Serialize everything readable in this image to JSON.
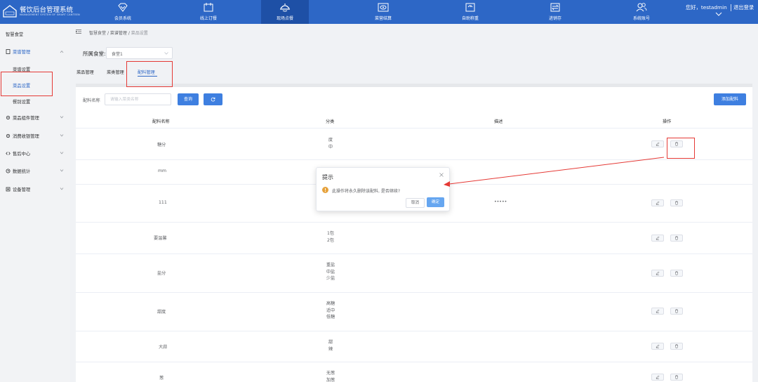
{
  "app": {
    "title": "餐饮后台管理系统",
    "subtitle": "MANAGEMENT SYSTEM OF SMART CANTEEN",
    "logo_text": "智慧食堂"
  },
  "nav": [
    {
      "label": "会员系统",
      "icon": "diamond-icon"
    },
    {
      "label": "线上订餐",
      "icon": "calendar-icon"
    },
    {
      "label": "现场点餐",
      "icon": "tray-icon",
      "active": true
    },
    {
      "label": "菜营结算",
      "icon": "eye-screen-icon"
    },
    {
      "label": "自助称重",
      "icon": "scale-icon"
    },
    {
      "label": "进销存",
      "icon": "exchange-icon"
    },
    {
      "label": "系统账号",
      "icon": "users-icon"
    }
  ],
  "user": {
    "greeting": "您好，testadmin",
    "logout": "退出登录"
  },
  "sidebar": {
    "head": "智慧食堂",
    "groups": [
      {
        "label": "菜谱管理",
        "open": true,
        "items": [
          "菜谱设置",
          "菜品设置",
          "餐别设置"
        ],
        "active_item": "菜品设置"
      },
      {
        "label": "菜品组件管理"
      },
      {
        "label": "消费收银管理"
      },
      {
        "label": "售后中心"
      },
      {
        "label": "数据统计"
      },
      {
        "label": "设备管理"
      }
    ]
  },
  "breadcrumb": {
    "items": [
      "智慧食堂",
      "菜谱管理",
      "菜品设置"
    ]
  },
  "filter": {
    "canteen_label": "所属食堂:",
    "canteen_value": "食堂1",
    "name_label": "配料名称",
    "name_placeholder": "请输入菜类名称",
    "search_label": "查询",
    "add_label": "添加配料"
  },
  "tabs": [
    {
      "label": "菜品管理"
    },
    {
      "label": "菜类管理"
    },
    {
      "label": "配料管理",
      "active": true
    }
  ],
  "table": {
    "headers": [
      "配料名称",
      "分类",
      "描述",
      "操作"
    ],
    "rows": [
      {
        "name": "糖分",
        "cats": [
          "度",
          "中"
        ],
        "desc": ""
      },
      {
        "name": "mm",
        "cats": [],
        "desc": ""
      },
      {
        "name": "111",
        "cats": [],
        "desc": "•••••"
      },
      {
        "name": "要温馨",
        "cats": [
          "1包",
          "2包"
        ],
        "desc": ""
      },
      {
        "name": "盐分",
        "cats": [
          "重盐",
          "中盐",
          "少盐"
        ],
        "desc": ""
      },
      {
        "name": "甜度",
        "cats": [
          "高糖",
          "适中",
          "低糖"
        ],
        "desc": ""
      },
      {
        "name": "大蒜",
        "cats": [
          "甜",
          "辣"
        ],
        "desc": ""
      },
      {
        "name": "葱",
        "cats": [
          "无葱",
          "加葱"
        ],
        "desc": ""
      }
    ]
  },
  "dialog": {
    "title": "提示",
    "message": "此操作将永久删除该配料, 是否继续?",
    "cancel": "取消",
    "confirm": "确定"
  },
  "colors": {
    "primary": "#2d67c6",
    "button": "#3e7fe0",
    "annotation": "#e53935",
    "warning": "#e6a23c"
  }
}
